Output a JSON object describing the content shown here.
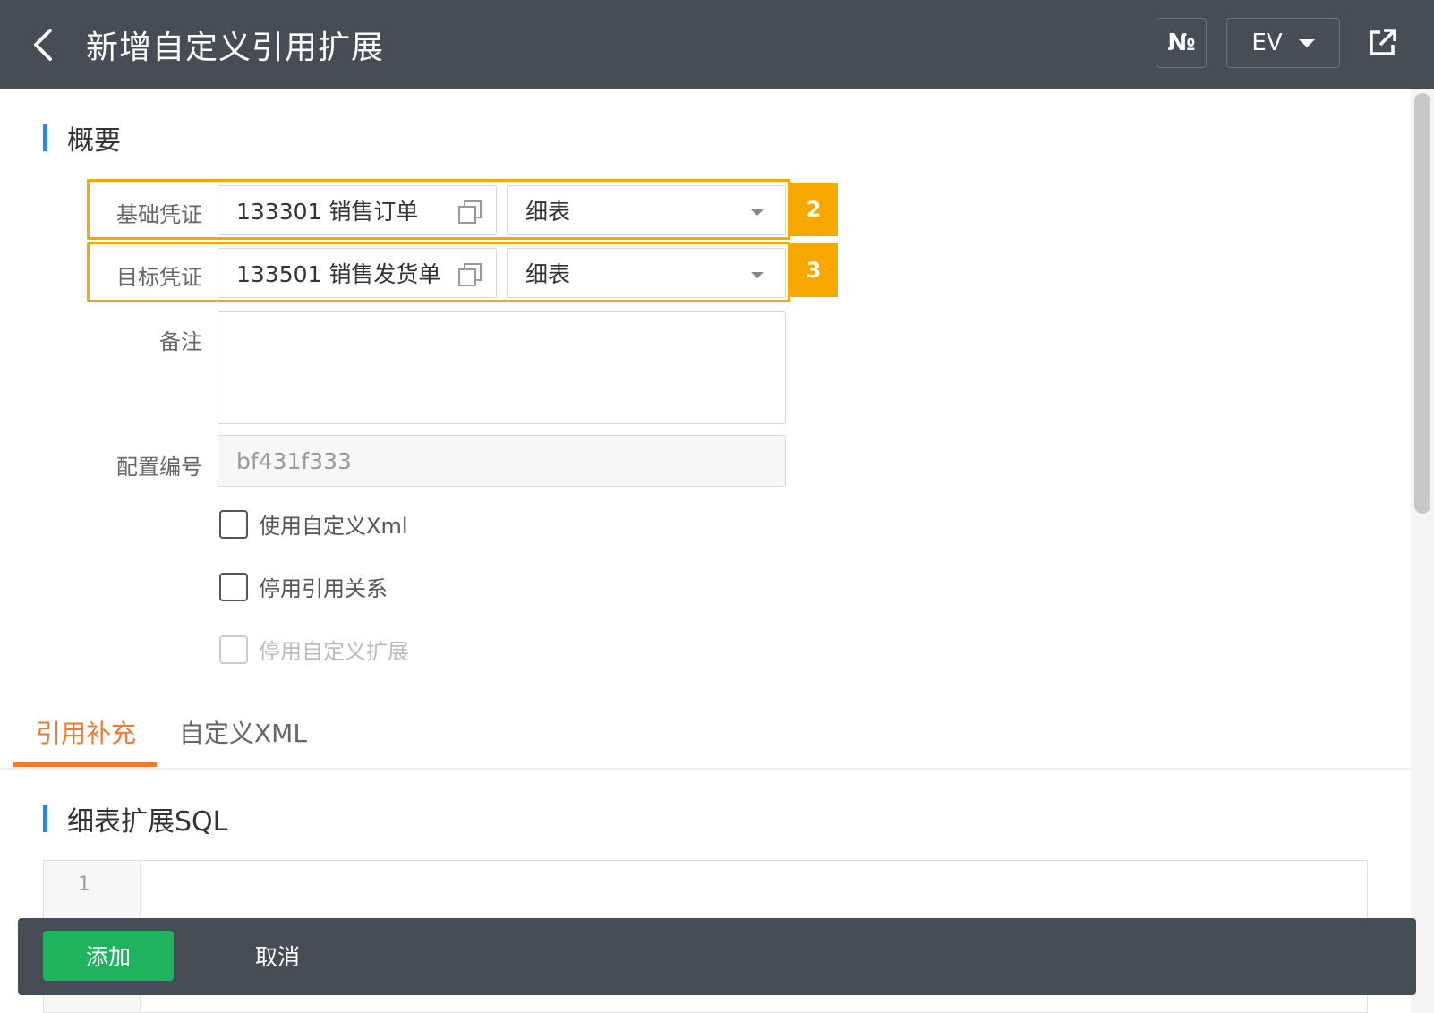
{
  "header": {
    "title": "新增自定义引用扩展",
    "no_label": "№",
    "env_label": "EV"
  },
  "summary": {
    "title": "概要",
    "base_voucher": {
      "label": "基础凭证",
      "value": "133301 销售订单",
      "table": "细表",
      "badge": "2"
    },
    "target_voucher": {
      "label": "目标凭证",
      "value": "133501 销售发货单",
      "table": "细表",
      "badge": "3"
    },
    "remark": {
      "label": "备注",
      "value": ""
    },
    "config_no": {
      "label": "配置编号",
      "value": "bf431f333"
    },
    "checkboxes": [
      {
        "label": "使用自定义Xml",
        "checked": false,
        "disabled": false
      },
      {
        "label": "停用引用关系",
        "checked": false,
        "disabled": false
      },
      {
        "label": "停用自定义扩展",
        "checked": false,
        "disabled": true
      }
    ]
  },
  "tabs": [
    {
      "label": "引用补充",
      "active": true
    },
    {
      "label": "自定义XML",
      "active": false
    }
  ],
  "sql_section": {
    "title": "细表扩展SQL",
    "line_numbers": [
      "1"
    ]
  },
  "footer": {
    "add_label": "添加",
    "cancel_label": "取消"
  },
  "colors": {
    "header_bg": "#474d55",
    "accent_blue": "#2f86e0",
    "tab_active": "#f07a2f",
    "highlight": "#f7a800",
    "add_button": "#1fb35f"
  }
}
